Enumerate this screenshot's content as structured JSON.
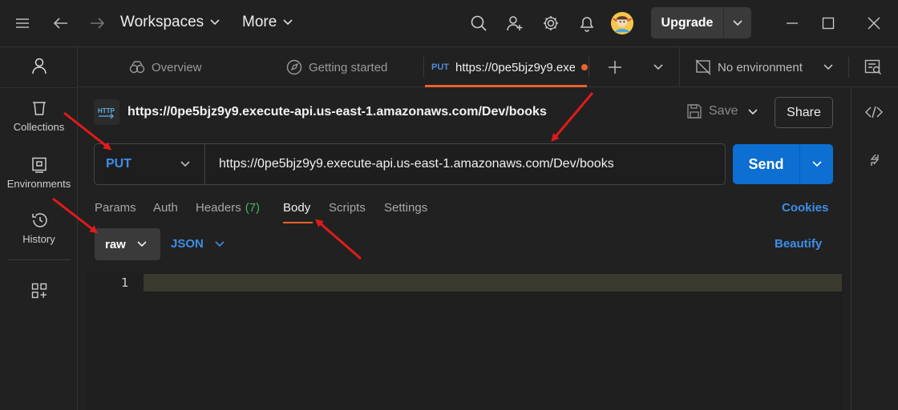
{
  "titlebar": {
    "workspaces_label": "Workspaces",
    "more_label": "More",
    "upgrade_label": "Upgrade"
  },
  "sidebar": {
    "items": [
      {
        "label": "Collections"
      },
      {
        "label": "Environments"
      },
      {
        "label": "History"
      }
    ]
  },
  "tabs": {
    "overview": "Overview",
    "getting_started": "Getting started",
    "active_method": "PUT",
    "active_title": "https://0pe5bjz9y9.exec",
    "environment": "No environment"
  },
  "request": {
    "title": "https://0pe5bjz9y9.execute-api.us-east-1.amazonaws.com/Dev/books",
    "save_label": "Save",
    "share_label": "Share",
    "method": "PUT",
    "url": "https://0pe5bjz9y9.execute-api.us-east-1.amazonaws.com/Dev/books",
    "send_label": "Send"
  },
  "subtabs": {
    "params": "Params",
    "auth": "Auth",
    "headers": "Headers",
    "headers_count": "(7)",
    "body": "Body",
    "scripts": "Scripts",
    "settings": "Settings",
    "cookies": "Cookies"
  },
  "body_options": {
    "mode": "raw",
    "format": "JSON",
    "beautify": "Beautify"
  },
  "editor": {
    "line_number": "1"
  },
  "colors": {
    "accent_blue": "#0c6fd1",
    "link_blue": "#3e8ee8",
    "active_tab_underline": "#e8622c",
    "annotation_red": "#e01b1b",
    "headers_count_green": "#49b36a"
  }
}
